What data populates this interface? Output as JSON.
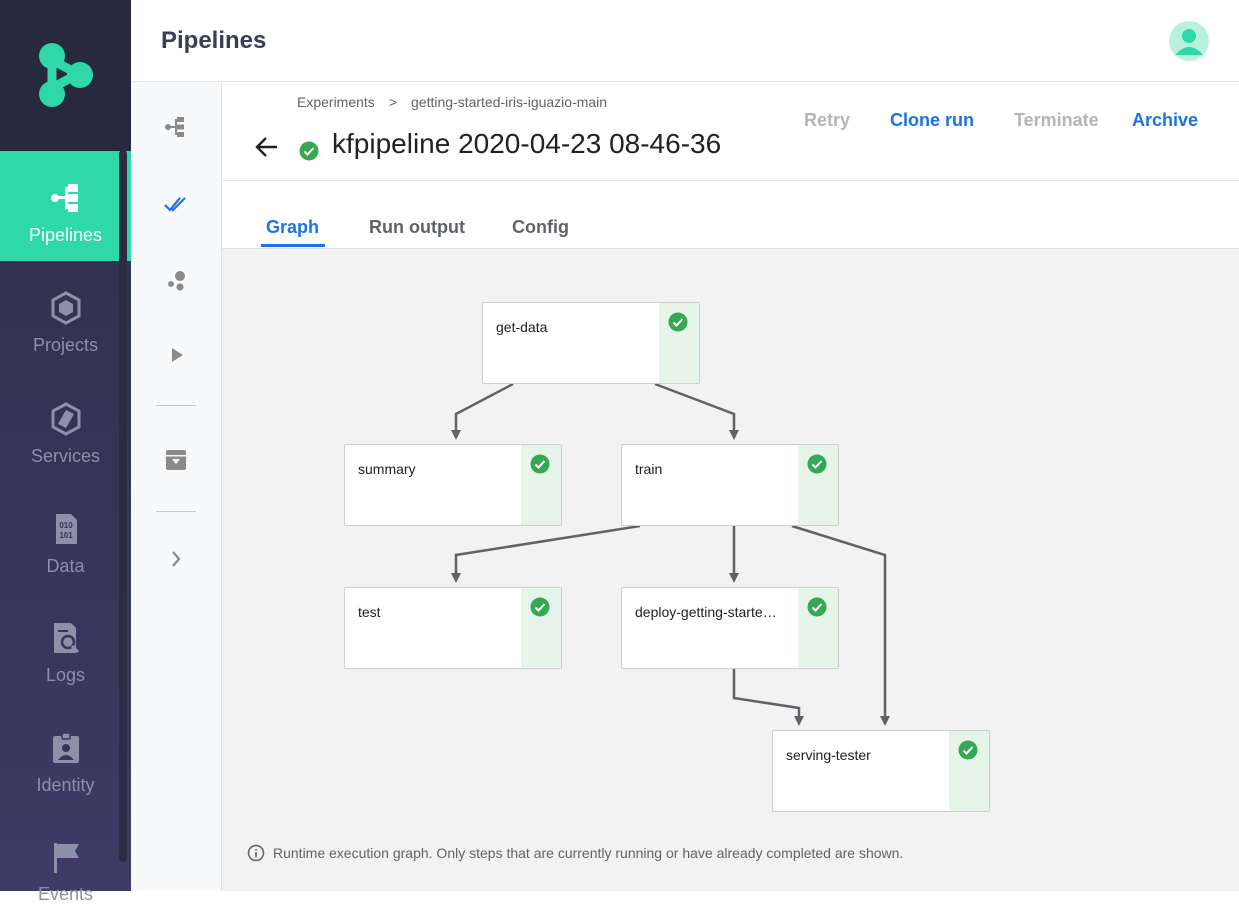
{
  "app": {
    "page_title": "Pipelines"
  },
  "appnav": {
    "items": [
      {
        "label": "Pipelines",
        "icon": "pipeline-icon",
        "active": true
      },
      {
        "label": "Projects",
        "icon": "projects-icon"
      },
      {
        "label": "Services",
        "icon": "services-icon"
      },
      {
        "label": "Data",
        "icon": "data-icon"
      },
      {
        "label": "Logs",
        "icon": "logs-icon"
      },
      {
        "label": "Identity",
        "icon": "identity-icon"
      },
      {
        "label": "Events",
        "icon": "events-icon"
      }
    ]
  },
  "subnav": {
    "icons": [
      "pipelines-icon",
      "runs-icon",
      "experiments-icon",
      "play-icon",
      "archive-icon",
      "chevron-right-icon"
    ]
  },
  "breadcrumb": {
    "items": [
      "Experiments",
      "getting-started-iris-iguazio-main"
    ],
    "separator": ">"
  },
  "run": {
    "title": "kfpipeline 2020-04-23 08-46-36",
    "status": "succeeded"
  },
  "actions": {
    "retry": "Retry",
    "clone": "Clone run",
    "terminate": "Terminate",
    "archive": "Archive"
  },
  "tabs": [
    "Graph",
    "Run output",
    "Config"
  ],
  "graph": {
    "nodes": [
      {
        "label": "get-data",
        "status": "succeeded"
      },
      {
        "label": "summary",
        "status": "succeeded"
      },
      {
        "label": "train",
        "status": "succeeded"
      },
      {
        "label": "test",
        "status": "succeeded"
      },
      {
        "label": "deploy-getting-starte…",
        "status": "succeeded"
      },
      {
        "label": "serving-tester",
        "status": "succeeded"
      }
    ],
    "edges": [
      [
        "get-data",
        "summary"
      ],
      [
        "get-data",
        "train"
      ],
      [
        "train",
        "test"
      ],
      [
        "train",
        "deploy-getting-starte…"
      ],
      [
        "train",
        "serving-tester"
      ],
      [
        "deploy-getting-starte…",
        "serving-tester"
      ]
    ],
    "footnote": "Runtime execution graph. Only steps that are currently running or have already completed are shown."
  },
  "colors": {
    "accent": "#1a73e8",
    "brand": "#2ed8a8",
    "success": "#34a853",
    "nav_bg": "#2c2f45"
  }
}
